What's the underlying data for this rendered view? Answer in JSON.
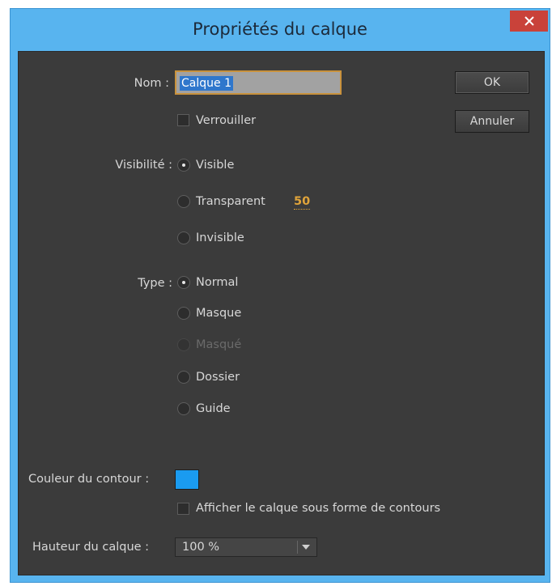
{
  "window": {
    "title": "Propriétés du calque",
    "close_icon": "close-icon"
  },
  "name": {
    "label": "Nom :",
    "value": "Calque 1"
  },
  "buttons": {
    "ok": "OK",
    "cancel": "Annuler"
  },
  "lock": {
    "label": "Verrouiller",
    "checked": false
  },
  "visibility": {
    "label": "Visibilité :",
    "options": [
      {
        "label": "Visible",
        "checked": true
      },
      {
        "label": "Transparent",
        "checked": false,
        "value": "50"
      },
      {
        "label": "Invisible",
        "checked": false
      }
    ]
  },
  "type": {
    "label": "Type :",
    "options": [
      {
        "label": "Normal",
        "checked": true,
        "enabled": true
      },
      {
        "label": "Masque",
        "checked": false,
        "enabled": true
      },
      {
        "label": "Masqué",
        "checked": false,
        "enabled": false
      },
      {
        "label": "Dossier",
        "checked": false,
        "enabled": true
      },
      {
        "label": "Guide",
        "checked": false,
        "enabled": true
      }
    ]
  },
  "outline": {
    "label": "Couleur du contour :",
    "color": "#1a9bf0",
    "show_as_outlines_label": "Afficher le calque sous forme de contours",
    "show_as_outlines_checked": false
  },
  "height": {
    "label": "Hauteur du calque :",
    "value": "100 %"
  },
  "colors": {
    "accent_border": "#c9923d",
    "value_orange": "#e0a43a",
    "selection": "#2f77cc"
  }
}
